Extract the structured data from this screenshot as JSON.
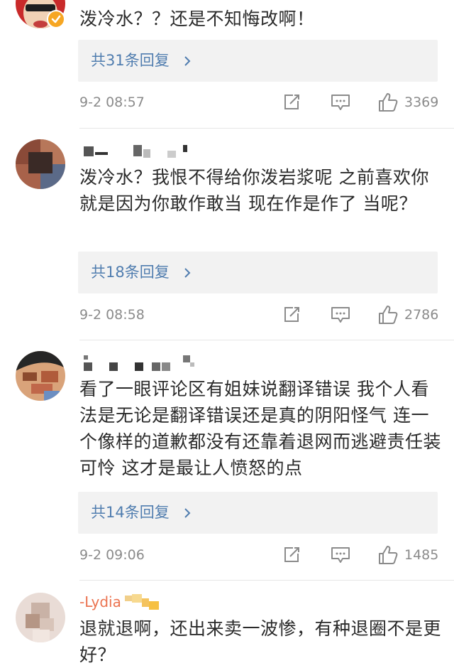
{
  "comments": [
    {
      "username": "",
      "verified": true,
      "text": "泼冷水？？还是不知悔改啊！",
      "replies_label": "共31条回复",
      "time": "9-2 08:57",
      "likes": "3369"
    },
    {
      "username": "",
      "verified": false,
      "text": "泼冷水？我恨不得给你泼岩浆呢 之前喜欢你就是因为你敢作敢当 现在作是作了 当呢？",
      "replies_label": "共18条回复",
      "time": "9-2 08:58",
      "likes": "2786"
    },
    {
      "username": "",
      "verified": false,
      "text": "看了一眼评论区有姐妹说翻译错误 我个人看法是无论是翻译错误还是真的阴阳怪气 连一个像样的道歉都没有还靠着退网而逃避责任装可怜 这才是最让人愤怒的点",
      "replies_label": "共14条回复",
      "time": "9-2 09:06",
      "likes": "1485"
    },
    {
      "username": "-Lydia",
      "verified": false,
      "text": "退就退啊，还出来卖一波惨，有种退圈不是更好？"
    }
  ],
  "icons": {
    "verified": "verified-badge-icon",
    "chevron": "chevron-right-icon",
    "repost": "repost-icon",
    "comment": "comment-icon",
    "like": "thumbs-up-icon"
  },
  "colors": {
    "link": "#507daf",
    "username": "#eb7350",
    "text": "#2b2b2b",
    "meta": "#8b8b8b",
    "reply_bg": "#f2f2f2",
    "verified": "#f6a623"
  }
}
